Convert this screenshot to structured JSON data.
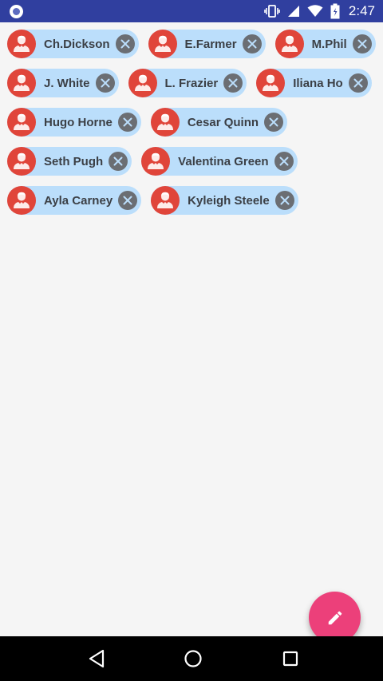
{
  "status_bar": {
    "time": "2:47",
    "icons": [
      "app-indicator-icon",
      "vibrate-icon",
      "cell-signal-icon",
      "wifi-icon",
      "battery-icon"
    ],
    "background_color": "#303f9f"
  },
  "chips": [
    {
      "label": "Ch.Dickson"
    },
    {
      "label": "E.Farmer"
    },
    {
      "label": "M.Phil"
    },
    {
      "label": "J. White"
    },
    {
      "label": "L. Frazier"
    },
    {
      "label": "Iliana Ho"
    },
    {
      "label": "Hugo Horne"
    },
    {
      "label": "Cesar Quinn"
    },
    {
      "label": "Seth Pugh"
    },
    {
      "label": "Valentina Green"
    },
    {
      "label": "Ayla Carney"
    },
    {
      "label": "Kyleigh Steele"
    }
  ],
  "chip_style": {
    "background_color": "#bbdefb",
    "avatar_color": "#e0453a",
    "close_color": "#6b6e73",
    "avatar_icon": "person-avatar-icon",
    "close_icon": "close-icon"
  },
  "fab": {
    "icon": "pencil-edit-icon",
    "color": "#ec407a"
  },
  "nav_bar": {
    "buttons": [
      "back-icon",
      "home-icon",
      "recents-icon"
    ]
  }
}
